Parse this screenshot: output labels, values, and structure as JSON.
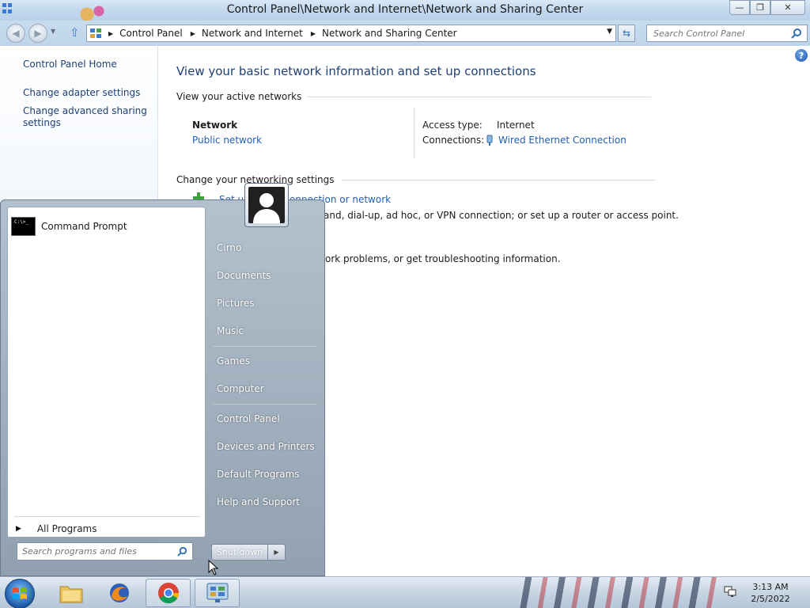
{
  "window": {
    "title": "Control Panel\\Network and Internet\\Network and Sharing Center",
    "minimize_icon": "minimize-icon",
    "restore_icon": "restore-icon",
    "close_icon": "close-icon"
  },
  "address": {
    "breadcrumbs": [
      "Control Panel",
      "Network and Internet",
      "Network and Sharing Center"
    ]
  },
  "search": {
    "placeholder": "Search Control Panel"
  },
  "sidebar": {
    "home": "Control Panel Home",
    "links": [
      "Change adapter settings",
      "Change advanced sharing settings"
    ]
  },
  "main": {
    "title": "View your basic network information and set up connections",
    "active_networks_heading": "View your active networks",
    "network_name": "Network",
    "network_type": "Public network",
    "access_type_label": "Access type:",
    "access_type_value": "Internet",
    "connections_label": "Connections:",
    "connections_value": "Wired Ethernet Connection",
    "settings_heading": "Change your networking settings",
    "task1_link": "Set up a new connection or network",
    "task1_desc": "and, dial-up, ad hoc, or VPN connection; or set up a router or access point.",
    "task2_desc": "ork problems, or get troubleshooting information."
  },
  "start_menu": {
    "programs": [
      {
        "label": "Command Prompt",
        "icon": "command-prompt-icon"
      }
    ],
    "all_programs": "All Programs",
    "search_placeholder": "Search programs and files",
    "right_items": [
      "Cirno",
      "Documents",
      "Pictures",
      "Music",
      "Games",
      "Computer",
      "Control Panel",
      "Devices and Printers",
      "Default Programs",
      "Help and Support"
    ],
    "shutdown_label": "Shut down"
  },
  "taskbar": {
    "apps": [
      {
        "name": "file-explorer",
        "icon": "folder-icon"
      },
      {
        "name": "firefox",
        "icon": "firefox-icon"
      },
      {
        "name": "chrome",
        "icon": "chrome-icon"
      },
      {
        "name": "control-panel",
        "icon": "control-panel-icon"
      }
    ],
    "time": "3:13 AM",
    "date": "2/5/2022"
  }
}
